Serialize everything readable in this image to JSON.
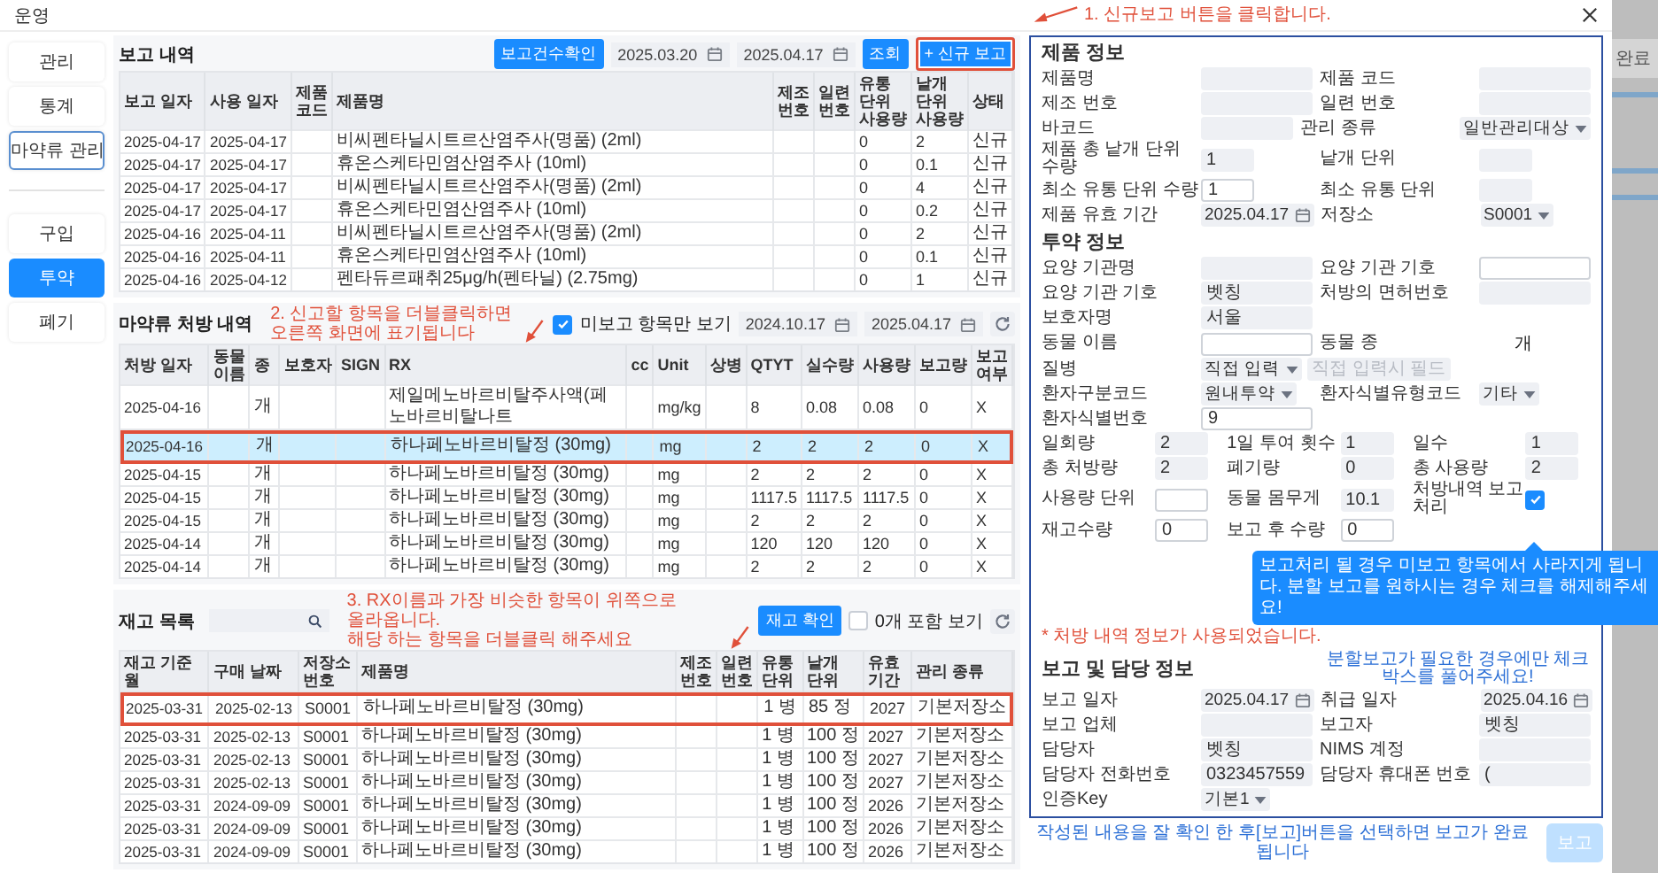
{
  "window": {
    "title": "운영"
  },
  "background_page": {
    "header": "완료"
  },
  "sidebar": {
    "groups": [
      {
        "kind": "menu",
        "items": [
          {
            "label": "관리",
            "selected": false
          },
          {
            "label": "통계",
            "selected": false
          },
          {
            "label": "마약류 관리",
            "selected": true
          }
        ]
      },
      {
        "kind": "submenu",
        "items": [
          {
            "label": "구입",
            "selected": false
          },
          {
            "label": "투약",
            "selected": true
          },
          {
            "label": "폐기",
            "selected": false
          }
        ]
      }
    ]
  },
  "report_history": {
    "title": "보고 내역",
    "count_button": "보고건수확인",
    "date_from": "2025.03.20",
    "date_to": "2025.04.17",
    "search_button": "조회",
    "new_button": {
      "label": "+ 신규 보고",
      "highlighted": true
    },
    "table": {
      "columns": [
        {
          "label": "보고 일자",
          "kind": "date"
        },
        {
          "label": "사용 일자",
          "kind": "date"
        },
        {
          "label": "제품 코드",
          "kind": "code"
        },
        {
          "label": "제품명",
          "kind": "name"
        },
        {
          "label": "제조 번호",
          "kind": "code"
        },
        {
          "label": "일련 번호",
          "kind": "code"
        },
        {
          "label": "유통 단위 사용량",
          "kind": "number"
        },
        {
          "label": "낱개 단위 사용량",
          "kind": "number"
        },
        {
          "label": "상태",
          "kind": "tag"
        }
      ],
      "rows": [
        {
          "cells": [
            "2025-04-17",
            "2025-04-17",
            null,
            "비씨펜타닐시트르산염주사(명품) (2ml)",
            null,
            null,
            "0",
            "2",
            "신규"
          ]
        },
        {
          "cells": [
            "2025-04-17",
            "2025-04-17",
            null,
            "휴온스케타민염산염주사 (10ml)",
            null,
            null,
            "0",
            "0.1",
            "신규"
          ]
        },
        {
          "cells": [
            "2025-04-17",
            "2025-04-17",
            null,
            "비씨펜타닐시트르산염주사(명품) (2ml)",
            null,
            null,
            "0",
            "4",
            "신규"
          ]
        },
        {
          "cells": [
            "2025-04-17",
            "2025-04-17",
            null,
            "휴온스케타민염산염주사 (10ml)",
            null,
            null,
            "0",
            "0.2",
            "신규"
          ]
        },
        {
          "cells": [
            "2025-04-16",
            "2025-04-11",
            null,
            "비씨펜타닐시트르산염주사(명품) (2ml)",
            null,
            null,
            "0",
            "2",
            "신규"
          ]
        },
        {
          "cells": [
            "2025-04-16",
            "2025-04-11",
            null,
            "휴온스케타민염산염주사 (10ml)",
            null,
            null,
            "0",
            "0.1",
            "신규"
          ]
        },
        {
          "cells": [
            "2025-04-16",
            "2025-04-12",
            null,
            "펜타듀르패취25μg/h(펜타닐) (2.75mg)",
            null,
            null,
            "0",
            "1",
            "신규"
          ]
        }
      ]
    }
  },
  "prescriptions": {
    "title": "마약류 처방 내역",
    "unreported_only": {
      "label": "미보고 항목만 보기",
      "checked": true
    },
    "date_from": "2024.10.17",
    "date_to": "2025.04.17",
    "table": {
      "columns": [
        {
          "label": "처방 일자",
          "kind": "date"
        },
        {
          "label": "동물 이름",
          "kind": "tag"
        },
        {
          "label": "종",
          "kind": "tag"
        },
        {
          "label": "보호자",
          "kind": "tag"
        },
        {
          "label": "SIGN",
          "kind": "code"
        },
        {
          "label": "RX",
          "kind": "name"
        },
        {
          "label": "cc",
          "kind": "code"
        },
        {
          "label": "Unit",
          "kind": "code"
        },
        {
          "label": "상병",
          "kind": "tag"
        },
        {
          "label": "QTYT",
          "kind": "number"
        },
        {
          "label": "실수량",
          "kind": "number"
        },
        {
          "label": "사용량",
          "kind": "number"
        },
        {
          "label": "보고량",
          "kind": "number"
        },
        {
          "label": "보고 여부",
          "kind": "code"
        }
      ],
      "rows": [
        {
          "selected": false,
          "cells": [
            "2025-04-16",
            null,
            "개",
            null,
            null,
            "제일메노바르비탈주사액(페노바르비탈나트",
            null,
            "mg/kg",
            null,
            "8",
            "0.08",
            "0.08",
            "0",
            "X"
          ]
        },
        {
          "selected": true,
          "cells": [
            "2025-04-16",
            null,
            "개",
            null,
            null,
            "하나페노바르비탈정 (30mg)",
            null,
            "mg",
            null,
            "2",
            "2",
            "2",
            "0",
            "X"
          ]
        },
        {
          "selected": false,
          "cells": [
            "2025-04-15",
            null,
            "개",
            null,
            null,
            "하나페노바르비탈정 (30mg)",
            null,
            "mg",
            null,
            "2",
            "2",
            "2",
            "0",
            "X"
          ]
        },
        {
          "selected": false,
          "cells": [
            "2025-04-15",
            null,
            "개",
            null,
            null,
            "하나페노바르비탈정 (30mg)",
            null,
            "mg",
            null,
            "1117.5",
            "1117.5",
            "1117.5",
            "0",
            "X"
          ]
        },
        {
          "selected": false,
          "cells": [
            "2025-04-15",
            null,
            "개",
            null,
            null,
            "하나페노바르비탈정 (30mg)",
            null,
            "mg",
            null,
            "2",
            "2",
            "2",
            "0",
            "X"
          ]
        },
        {
          "selected": false,
          "cells": [
            "2025-04-14",
            null,
            "개",
            null,
            null,
            "하나페노바르비탈정 (30mg)",
            null,
            "mg",
            null,
            "120",
            "120",
            "120",
            "0",
            "X"
          ]
        },
        {
          "selected": false,
          "cells": [
            "2025-04-14",
            null,
            "개",
            null,
            null,
            "하나페노바르비탈정 (30mg)",
            null,
            "mg",
            null,
            "2",
            "2",
            "2",
            "0",
            "X"
          ]
        }
      ]
    }
  },
  "inventory": {
    "title": "재고 목록",
    "check_button": "재고 확인",
    "include_zero": {
      "label": "0개 포함 보기",
      "checked": false
    },
    "table": {
      "columns": [
        {
          "label": "재고 기준 월",
          "kind": "date"
        },
        {
          "label": "구매 날짜",
          "kind": "date"
        },
        {
          "label": "저장소 번호",
          "kind": "code"
        },
        {
          "label": "제품명",
          "kind": "name"
        },
        {
          "label": "제조 번호",
          "kind": "code"
        },
        {
          "label": "일련 번호",
          "kind": "code"
        },
        {
          "label": "유통 단위",
          "kind": "tag"
        },
        {
          "label": "낱개 단위",
          "kind": "tag"
        },
        {
          "label": "유효 기간",
          "kind": "number"
        },
        {
          "label": "관리 종류",
          "kind": "tag"
        }
      ],
      "rows": [
        {
          "highlighted": true,
          "cells": [
            "2025-03-31",
            "2025-02-13",
            "S0001",
            "하나페노바르비탈정 (30mg)",
            null,
            null,
            "1 병",
            "85 정",
            "2027",
            "기본저장소"
          ]
        },
        {
          "highlighted": false,
          "cells": [
            "2025-03-31",
            "2025-02-13",
            "S0001",
            "하나페노바르비탈정 (30mg)",
            null,
            null,
            "1 병",
            "100 정",
            "2027",
            "기본저장소"
          ]
        },
        {
          "highlighted": false,
          "cells": [
            "2025-03-31",
            "2025-02-13",
            "S0001",
            "하나페노바르비탈정 (30mg)",
            null,
            null,
            "1 병",
            "100 정",
            "2027",
            "기본저장소"
          ]
        },
        {
          "highlighted": false,
          "cells": [
            "2025-03-31",
            "2025-02-13",
            "S0001",
            "하나페노바르비탈정 (30mg)",
            null,
            null,
            "1 병",
            "100 정",
            "2027",
            "기본저장소"
          ]
        },
        {
          "highlighted": false,
          "cells": [
            "2025-03-31",
            "2024-09-09",
            "S0001",
            "하나페노바르비탈정 (30mg)",
            null,
            null,
            "1 병",
            "100 정",
            "2026",
            "기본저장소"
          ]
        },
        {
          "highlighted": false,
          "cells": [
            "2025-03-31",
            "2024-09-09",
            "S0001",
            "하나페노바르비탈정 (30mg)",
            null,
            null,
            "1 병",
            "100 정",
            "2026",
            "기본저장소"
          ]
        },
        {
          "highlighted": false,
          "cells": [
            "2025-03-31",
            "2024-09-09",
            "S0001",
            "하나페노바르비탈정 (30mg)",
            null,
            null,
            "1 병",
            "100 정",
            "2026",
            "기본저장소"
          ]
        }
      ]
    }
  },
  "annotations": [
    {
      "lines": [
        "1. 신규보고 버튼을 클릭합니다."
      ]
    },
    {
      "lines": [
        "2. 신고할 항목을 더블클릭하면 오른쪽 화면에 표기됩니다"
      ]
    },
    {
      "lines": [
        "3. RX이름과 가장 비슷한 항목이 위쪽으로 올라옵니다.",
        "해당 하는 항목을 더블클릭 해주세요"
      ]
    }
  ],
  "detail_panel": {
    "sections": [
      {
        "title": "제품 정보",
        "rows": [
          {
            "kind": "pair",
            "pairs": [
              {
                "label": "제품명",
                "fields": [
                  {
                    "kind": "text"
                  }
                ]
              },
              {
                "label": "제품 코드",
                "fields": [
                  {
                    "kind": "text"
                  }
                ]
              }
            ]
          },
          {
            "kind": "pair",
            "pairs": [
              {
                "label": "제조 번호",
                "fields": [
                  {
                    "kind": "text"
                  }
                ]
              },
              {
                "label": "일련 번호",
                "fields": [
                  {
                    "kind": "text"
                  }
                ]
              }
            ]
          },
          {
            "kind": "pair",
            "pairs": [
              {
                "label": "바코드",
                "fields": [
                  {
                    "kind": "text"
                  }
                ]
              },
              {
                "label": "관리 종류",
                "fields": [
                  {
                    "kind": "select",
                    "value": "일반관리대상"
                  }
                ]
              }
            ]
          },
          {
            "kind": "pair",
            "pairs": [
              {
                "label": "제품 총 낱개 단위 수량",
                "fields": [
                  {
                    "kind": "short-text",
                    "value": "1"
                  }
                ]
              },
              {
                "label": "낱개 단위",
                "fields": [
                  {
                    "kind": "short-text"
                  }
                ]
              }
            ]
          },
          {
            "kind": "pair",
            "pairs": [
              {
                "label": "최소 유통 단위 수량",
                "fields": [
                  {
                    "kind": "short-input",
                    "value": "1"
                  }
                ]
              },
              {
                "label": "최소 유통 단위",
                "fields": [
                  {
                    "kind": "short-text"
                  }
                ]
              }
            ]
          },
          {
            "kind": "pair",
            "pairs": [
              {
                "label": "제품 유효 기간",
                "fields": [
                  {
                    "kind": "date",
                    "value": "2025.04.17"
                  }
                ]
              },
              {
                "label": "저장소",
                "fields": [
                  {
                    "kind": "select",
                    "value": "S0001"
                  }
                ]
              }
            ]
          }
        ]
      },
      {
        "title": "투약 정보",
        "note": "* 처방 내역 정보가 사용되었습니다.",
        "tooltip": "보고처리 될 경우 미보고 항목에서 사라지게 됩니다. 분할 보고를 원하시는 경우 체크를 해제해주세요!",
        "rows": [
          {
            "kind": "pair",
            "pairs": [
              {
                "label": "요양 기관명",
                "fields": [
                  {
                    "kind": "text"
                  }
                ]
              },
              {
                "label": "요양 기관 기호",
                "fields": [
                  {
                    "kind": "input"
                  }
                ]
              }
            ]
          },
          {
            "kind": "pair",
            "pairs": [
              {
                "label": "요양 기관 기호",
                "fields": [
                  {
                    "kind": "text",
                    "value": "벳칭"
                  }
                ]
              },
              {
                "label": "처방의 면허번호",
                "fields": [
                  {
                    "kind": "text"
                  }
                ]
              }
            ]
          },
          {
            "kind": "pair",
            "pairs": [
              {
                "label": "보호자명",
                "fields": [
                  {
                    "kind": "text",
                    "value": "서울"
                  }
                ]
              }
            ]
          },
          {
            "kind": "pair",
            "pairs": [
              {
                "label": "동물 이름",
                "fields": [
                  {
                    "kind": "input"
                  }
                ]
              },
              {
                "label": "동물 종",
                "fields": [
                  {
                    "kind": "static",
                    "value": "개"
                  }
                ]
              }
            ]
          },
          {
            "kind": "pair",
            "pairs": [
              {
                "label": "질병",
                "fields": [
                  {
                    "kind": "select",
                    "value": "직접 입력"
                  },
                  {
                    "kind": "text",
                    "placeholder": "직접 입력시 필드"
                  }
                ]
              }
            ]
          },
          {
            "kind": "pair",
            "pairs": [
              {
                "label": "환자구분코드",
                "fields": [
                  {
                    "kind": "select",
                    "value": "원내투약"
                  }
                ]
              },
              {
                "label": "환자식별유형코드",
                "fields": [
                  {
                    "kind": "select",
                    "value": "기타"
                  }
                ]
              }
            ]
          },
          {
            "kind": "pair",
            "pairs": [
              {
                "label": "환자식별번호",
                "fields": [
                  {
                    "kind": "input",
                    "value": "9"
                  }
                ]
              }
            ]
          },
          {
            "kind": "triple",
            "pairs": [
              {
                "label": "일회량",
                "fields": [
                  {
                    "kind": "short-text",
                    "value": "2"
                  }
                ]
              },
              {
                "label": "1일 투여 횟수",
                "fields": [
                  {
                    "kind": "short-text",
                    "value": "1"
                  }
                ]
              },
              {
                "label": "일수",
                "fields": [
                  {
                    "kind": "short-text",
                    "value": "1"
                  }
                ]
              }
            ]
          },
          {
            "kind": "triple",
            "pairs": [
              {
                "label": "총 처방량",
                "fields": [
                  {
                    "kind": "short-text",
                    "value": "2"
                  }
                ]
              },
              {
                "label": "폐기량",
                "fields": [
                  {
                    "kind": "short-text",
                    "value": "0"
                  }
                ]
              },
              {
                "label": "총 사용량",
                "fields": [
                  {
                    "kind": "short-text",
                    "value": "2"
                  }
                ]
              }
            ]
          },
          {
            "kind": "triple",
            "pairs": [
              {
                "label": "사용량 단위",
                "fields": [
                  {
                    "kind": "short-input"
                  }
                ]
              },
              {
                "label": "동물 몸무게",
                "fields": [
                  {
                    "kind": "short-text",
                    "value": "10.1"
                  }
                ]
              },
              {
                "label": "처방내역 보고처리",
                "fields": [
                  {
                    "kind": "check",
                    "checked": true
                  }
                ]
              }
            ]
          },
          {
            "kind": "triple",
            "pairs": [
              {
                "label": "재고수량",
                "fields": [
                  {
                    "kind": "short-input",
                    "value": "0"
                  }
                ]
              },
              {
                "label": "보고 후 수량",
                "fields": [
                  {
                    "kind": "short-input",
                    "value": "0"
                  }
                ]
              }
            ]
          }
        ]
      },
      {
        "title": "보고 및 담당 정보",
        "hint": "분할보고가 필요한 경우에만 체크박스를 풀어주세요!",
        "rows": [
          {
            "kind": "pair",
            "pairs": [
              {
                "label": "보고 일자",
                "fields": [
                  {
                    "kind": "date",
                    "value": "2025.04.17"
                  }
                ]
              },
              {
                "label": "취급 일자",
                "fields": [
                  {
                    "kind": "date",
                    "value": "2025.04.16"
                  }
                ]
              }
            ]
          },
          {
            "kind": "pair",
            "pairs": [
              {
                "label": "보고 업체",
                "fields": [
                  {
                    "kind": "text"
                  }
                ]
              },
              {
                "label": "보고자",
                "fields": [
                  {
                    "kind": "text",
                    "value": "벳칭"
                  }
                ]
              }
            ]
          },
          {
            "kind": "pair",
            "pairs": [
              {
                "label": "담당자",
                "fields": [
                  {
                    "kind": "text",
                    "value": "벳칭"
                  }
                ]
              },
              {
                "label": "NIMS 계정",
                "fields": [
                  {
                    "kind": "text"
                  }
                ]
              }
            ]
          },
          {
            "kind": "pair",
            "pairs": [
              {
                "label": "담당자 전화번호",
                "fields": [
                  {
                    "kind": "text",
                    "value": "0323457559"
                  }
                ]
              },
              {
                "label": "담당자 휴대폰 번호",
                "fields": [
                  {
                    "kind": "text",
                    "value": "("
                  }
                ]
              }
            ]
          },
          {
            "kind": "pair",
            "pairs": [
              {
                "label": "인증Key",
                "fields": [
                  {
                    "kind": "select",
                    "value": "기본1"
                  }
                ]
              }
            ]
          }
        ]
      }
    ]
  },
  "footer": {
    "text": "작성된 내용을 잘 확인 한 후[보고]버튼을 선택하면 보고가 완료됩니다",
    "submit_button": {
      "label": "보고",
      "disabled": true
    }
  }
}
